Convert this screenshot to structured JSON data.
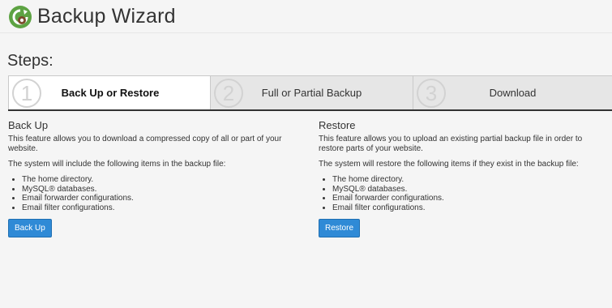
{
  "header": {
    "title": "Backup Wizard",
    "logo_icon": "backup-wizard-icon"
  },
  "steps": {
    "heading": "Steps:",
    "items": [
      {
        "number": "1",
        "label": "Back Up or Restore",
        "active": true
      },
      {
        "number": "2",
        "label": "Full or Partial Backup",
        "active": false
      },
      {
        "number": "3",
        "label": "Download",
        "active": false
      }
    ]
  },
  "backup": {
    "title": "Back Up",
    "description": "This feature allows you to download a compressed copy of all or part of your website.",
    "list_intro": "The system will include the following items in the backup file:",
    "items": [
      "The home directory.",
      "MySQL® databases.",
      "Email forwarder configurations.",
      "Email filter configurations."
    ],
    "button_label": "Back Up"
  },
  "restore": {
    "title": "Restore",
    "description": "This feature allows you to upload an existing partial backup file in order to restore parts of your website.",
    "list_intro": "The system will restore the following items if they exist in the backup file:",
    "items": [
      "The home directory.",
      "MySQL® databases.",
      "Email forwarder configurations.",
      "Email filter configurations."
    ],
    "button_label": "Restore"
  },
  "colors": {
    "accent": "#2f8ad6",
    "logo_green": "#5da343",
    "active_step_border": "#333333"
  }
}
